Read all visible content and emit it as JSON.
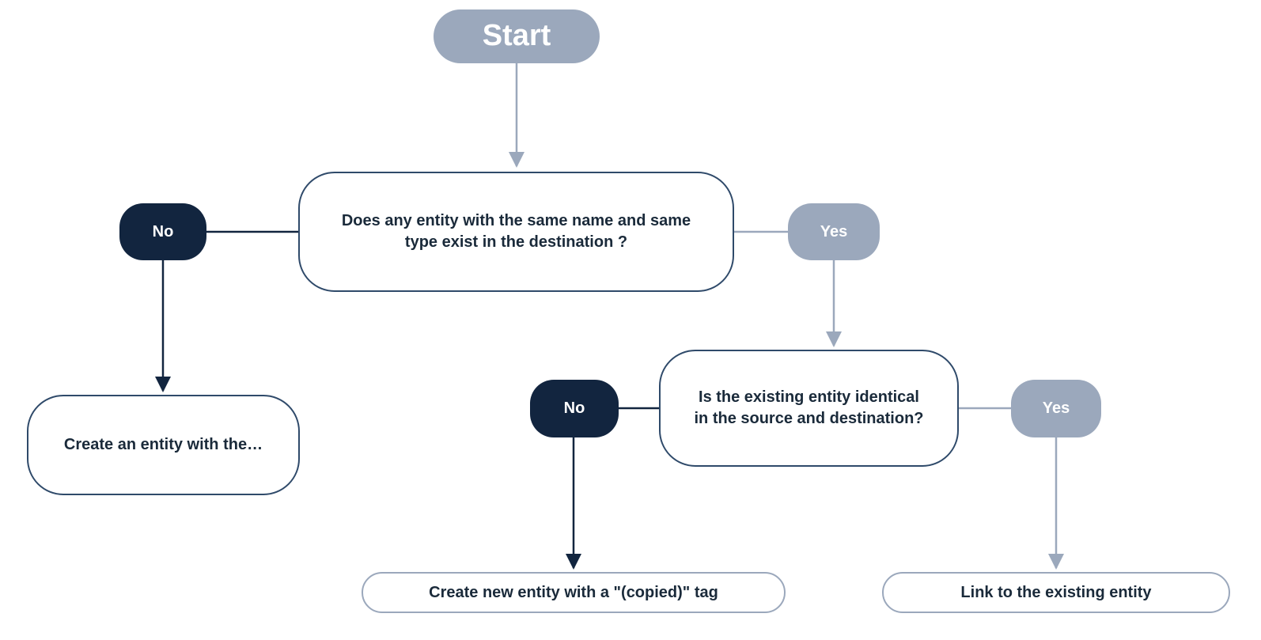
{
  "flow": {
    "start": "Start",
    "decision1": "Does any entity with the same name and same type exist in the destination ?",
    "decision2": "Is the existing entity identical in the source and destination?",
    "no1": "No",
    "yes1": "Yes",
    "no2": "No",
    "yes2": "Yes",
    "outcome_create_same": "Create an entity with the…",
    "outcome_copied": "Create new entity with a \"(copied)\" tag",
    "outcome_link": "Link to the existing entity"
  },
  "colors": {
    "light_blue_gray": "#9ba8bc",
    "dark_navy": "#12253f",
    "border_dark": "#2f4a6a",
    "text_dark": "#1a2a3a"
  }
}
